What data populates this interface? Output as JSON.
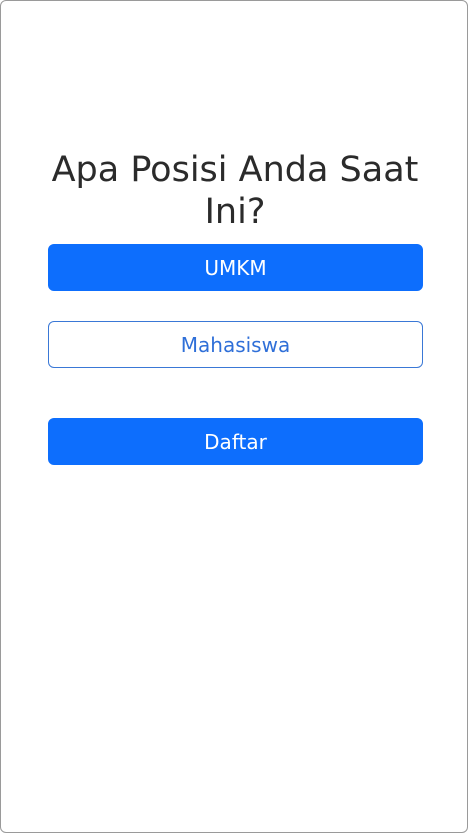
{
  "question": {
    "title": "Apa Posisi Anda Saat Ini?"
  },
  "options": [
    {
      "label": "UMKM",
      "selected": true
    },
    {
      "label": "Mahasiswa",
      "selected": false
    }
  ],
  "actions": {
    "submit_label": "Daftar"
  },
  "colors": {
    "primary": "#0d6efd",
    "outline_text": "#2f6fd8",
    "title_text": "#2b2b2b",
    "background": "#ffffff"
  }
}
